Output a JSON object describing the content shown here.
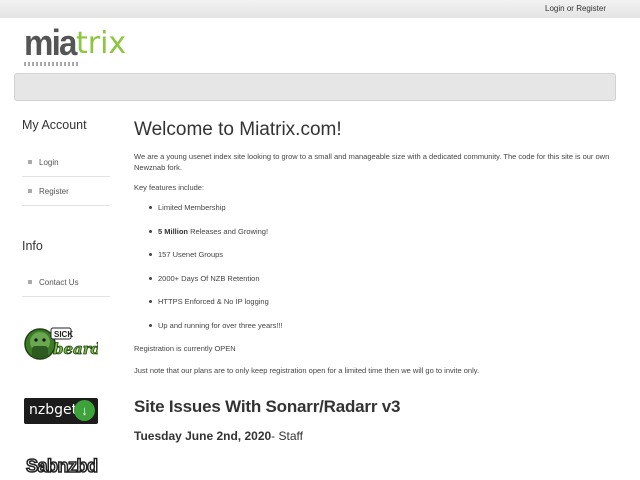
{
  "header": {
    "login_link": "Login",
    "or_text": "or",
    "register_link": "Register"
  },
  "logo": {
    "part1": "mia",
    "part2": "trix"
  },
  "sidebar": {
    "account_heading": "My Account",
    "account_items": [
      {
        "label": "Login"
      },
      {
        "label": "Register"
      }
    ],
    "info_heading": "Info",
    "info_items": [
      {
        "label": "Contact Us"
      }
    ],
    "badges": {
      "sickbeard": "SICK",
      "sickbeard2": "beard",
      "nzbget": "nzbget",
      "sabnzbd": "Sabnzbd"
    }
  },
  "main": {
    "title": "Welcome to Miatrix.com!",
    "intro": "We are a young usenet index site looking to grow to a small and manageable size with a dedicated community. The code for this site is our own Newznab fork.",
    "key_features_label": "Key features include:",
    "features": [
      {
        "text": "Limited Membership"
      },
      {
        "bold": "5 Million",
        "text": " Releases and Growing!"
      },
      {
        "text": "157 Usenet Groups"
      },
      {
        "text": "2000+ Days Of NZB Retention"
      },
      {
        "text": "HTTPS Enforced & No IP logging"
      },
      {
        "text": "Up and running for over three years!!!"
      }
    ],
    "registration_label": "Registration is currently",
    "registration_status": "OPEN",
    "note": "Just note that our plans are to only keep registration open for a limited time then we will go to invite only.",
    "news_title": "Site Issues With Sonarr/Radarr v3",
    "news_date": "Tuesday June 2nd, 2020",
    "news_author_sep": "- Staff"
  },
  "colors": {
    "logo_green": "#8cc63f",
    "nav_bg": "#e6e6e6",
    "nzbget_green": "#3ea23a"
  }
}
